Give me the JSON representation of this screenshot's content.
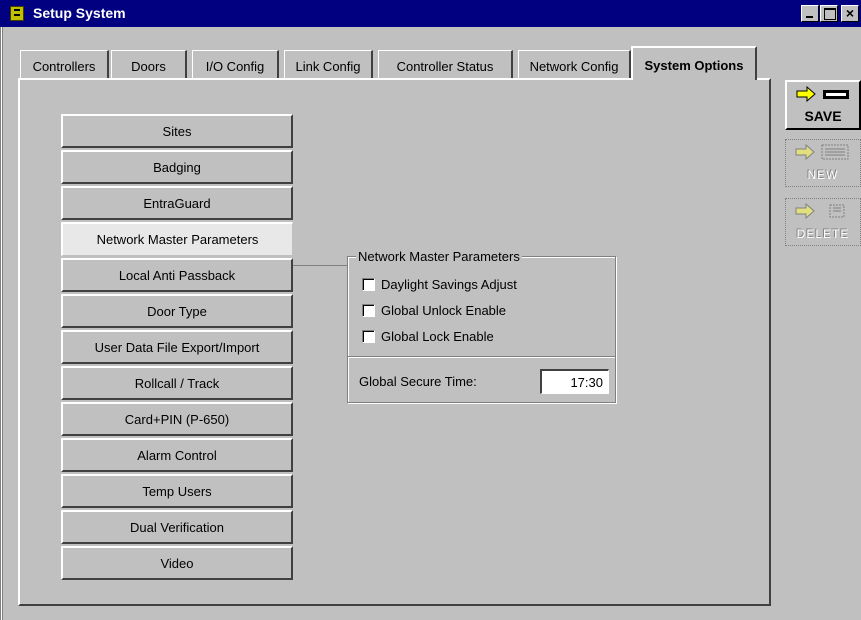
{
  "window": {
    "title": "Setup System"
  },
  "tabs": [
    {
      "label": "Controllers"
    },
    {
      "label": "Doors"
    },
    {
      "label": "I/O Config"
    },
    {
      "label": "Link Config"
    },
    {
      "label": "Controller Status"
    },
    {
      "label": "Network Config"
    },
    {
      "label": "System Options",
      "active": true
    }
  ],
  "options": [
    {
      "label": "Sites"
    },
    {
      "label": "Badging"
    },
    {
      "label": "EntraGuard"
    },
    {
      "label": "Network Master Parameters",
      "selected": true
    },
    {
      "label": "Local Anti Passback"
    },
    {
      "label": "Door Type"
    },
    {
      "label": "User Data File Export/Import"
    },
    {
      "label": "Rollcall / Track"
    },
    {
      "label": "Card+PIN (P-650)"
    },
    {
      "label": "Alarm Control"
    },
    {
      "label": "Temp Users"
    },
    {
      "label": "Dual Verification"
    },
    {
      "label": "Video"
    }
  ],
  "params": {
    "title": "Network Master Parameters",
    "checkboxes": [
      {
        "label": "Daylight Savings Adjust",
        "checked": false
      },
      {
        "label": "Global Unlock Enable",
        "checked": false
      },
      {
        "label": "Global Lock Enable",
        "checked": false
      }
    ],
    "secure_time_label": "Global Secure Time:",
    "secure_time_value": "17:30"
  },
  "actions": {
    "save_label": "SAVE",
    "new_label": "NEW",
    "delete_label": "DELETE"
  },
  "colors": {
    "titlebar": "#000080",
    "face": "#c0c0c0",
    "arrow": "#ffff00"
  }
}
